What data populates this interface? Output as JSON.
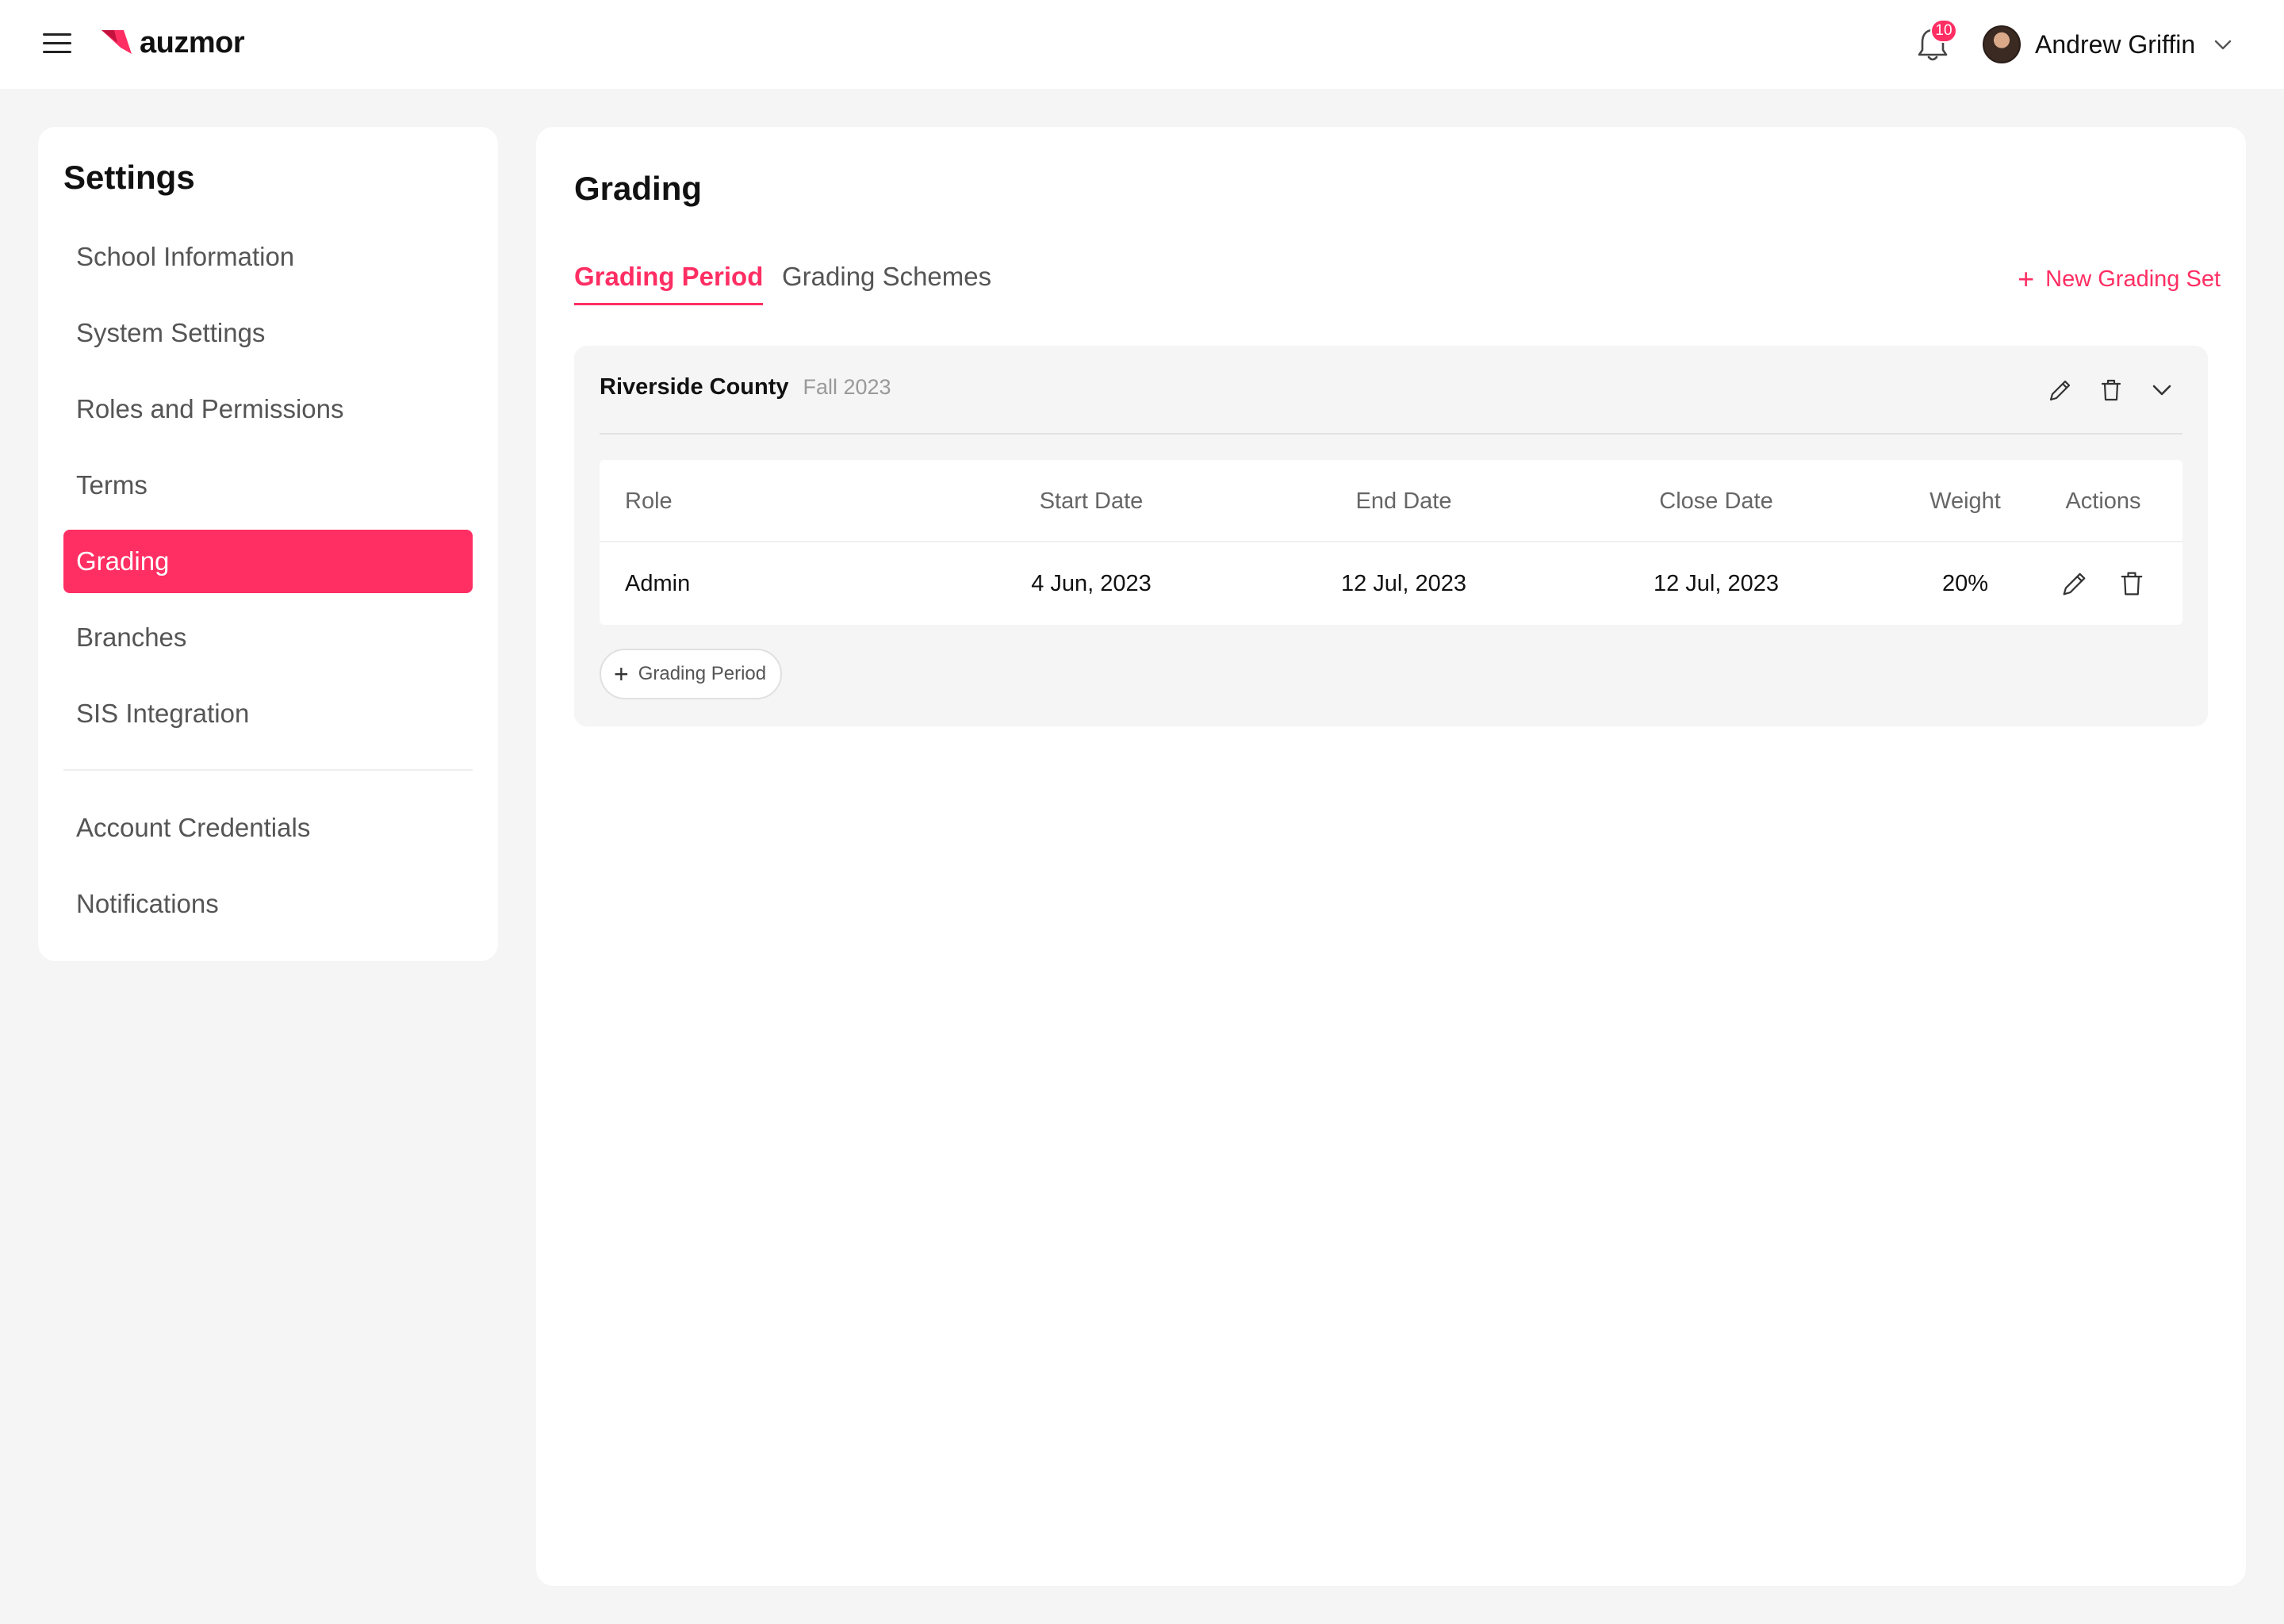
{
  "app": {
    "brand": "auzmor",
    "accent": "#ff2e63",
    "notifications_count": "10"
  },
  "user": {
    "name": "Andrew Griffin"
  },
  "sidebar": {
    "title": "Settings",
    "items": [
      {
        "label": "School Information",
        "active": false
      },
      {
        "label": "System Settings",
        "active": false
      },
      {
        "label": "Roles and Permissions",
        "active": false
      },
      {
        "label": "Terms",
        "active": false
      },
      {
        "label": "Grading",
        "active": true
      },
      {
        "label": "Branches",
        "active": false
      },
      {
        "label": "SIS Integration",
        "active": false
      }
    ],
    "secondary_items": [
      {
        "label": "Account Credentials"
      },
      {
        "label": "Notifications"
      }
    ]
  },
  "main": {
    "title": "Grading",
    "tabs": [
      {
        "label": "Grading Period",
        "active": true
      },
      {
        "label": "Grading Schemes",
        "active": false
      }
    ],
    "new_set_label": "New Grading Set",
    "card": {
      "name": "Riverside County",
      "term": "Fall 2023",
      "table": {
        "columns": [
          "Role",
          "Start Date",
          "End Date",
          "Close Date",
          "Weight",
          "Actions"
        ],
        "rows": [
          {
            "role": "Admin",
            "start": "4 Jun, 2023",
            "end": "12 Jul, 2023",
            "close": "12 Jul, 2023",
            "weight": "20%"
          }
        ]
      },
      "add_period_label": "Grading Period"
    }
  }
}
